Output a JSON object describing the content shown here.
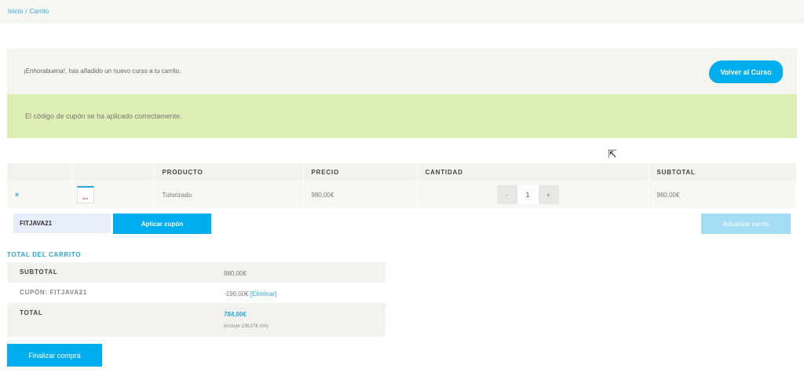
{
  "breadcrumb": {
    "home": "Inicio",
    "separator": "/",
    "current": "Carrito"
  },
  "notice": {
    "message": "¡Enhorabuena!, has añadido un nuevo curso a tu carrito.",
    "button_label": "Volver al Curso"
  },
  "success": {
    "message": "El código de cupón se ha aplicado correctamente."
  },
  "cart": {
    "headers": [
      "",
      "",
      "PRODUCTO",
      "PRECIO",
      "CANTIDAD",
      "SUBTOTAL"
    ],
    "items": [
      {
        "remove_icon": "×",
        "thumbnail_label": "java",
        "product": "Tutorizado",
        "price": "980,00€",
        "qty_minus": "-",
        "quantity": "1",
        "qty_plus": "+",
        "subtotal": "980,00€"
      }
    ]
  },
  "coupon": {
    "value": "FITJAVA21",
    "apply_label": "Aplicar cupón",
    "update_label": "Actualizar carrito"
  },
  "totals": {
    "title": "TOTAL DEL CARRITO",
    "subtotal_label": "SUBTOTAL",
    "subtotal_value": "980,00€",
    "coupon_label": "CUPÓN: FITJAVA21",
    "coupon_value": "-196,00€",
    "coupon_remove": "[Eliminar]",
    "total_label": "TOTAL",
    "total_value": "784,00€",
    "tax_note": "(incluye 136,07€ IVA)"
  },
  "checkout": {
    "label": "Finalizar compra"
  },
  "colors": {
    "accent": "#00adef",
    "success_bg": "#deefb3",
    "panel_bg": "#f5f4ef"
  }
}
